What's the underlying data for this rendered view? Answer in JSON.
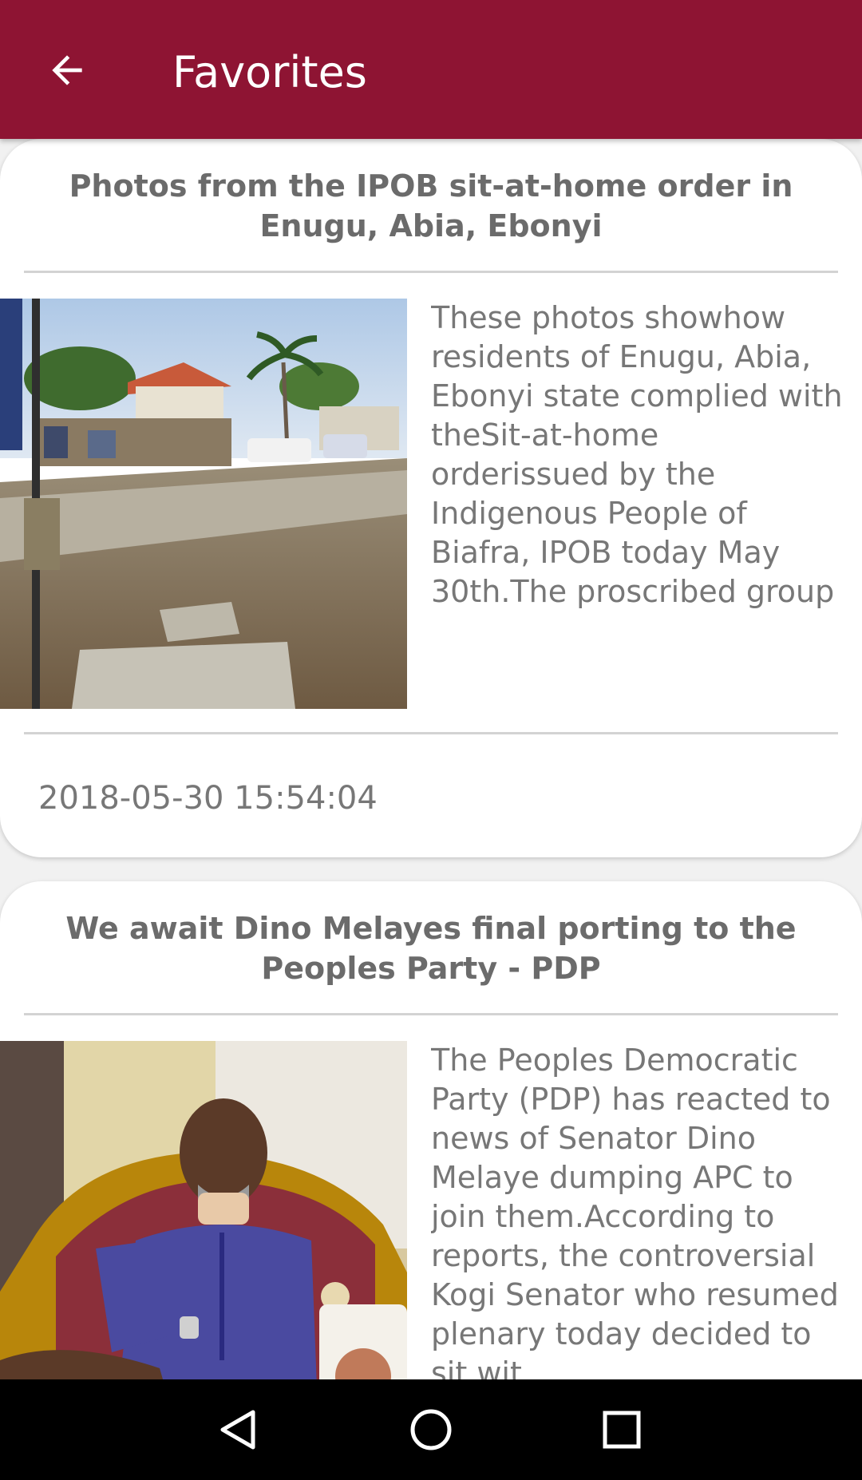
{
  "app_bar": {
    "title": "Favorites",
    "back_icon": "arrow-back-icon",
    "color": "#8e1433"
  },
  "articles": [
    {
      "title": "Photos from the IPOB sit-at-home order in Enugu, Abia, Ebonyi",
      "summary": "These photos showhow residents of Enugu, Abia, Ebonyi state complied with theSit-at-home orderissued by the Indigenous People of Biafra, IPOB today May 30th.The proscribed group ordered their members ...",
      "timestamp": "2018-05-30 15:54:04",
      "image": "street-scene-photo"
    },
    {
      "title": "We await Dino Melayes final porting to the Peoples Party - PDP",
      "summary": "The Peoples Democratic Party (PDP) has reacted to news of Senator Dino Melaye dumping APC to join them.According to reports, the controversial Kogi Senator who resumed plenary today decided to sit wit...",
      "image": "senator-portrait-photo"
    }
  ],
  "nav_bar": {
    "back_icon": "triangle-back-icon",
    "home_icon": "circle-home-icon",
    "recents_icon": "square-recents-icon"
  }
}
